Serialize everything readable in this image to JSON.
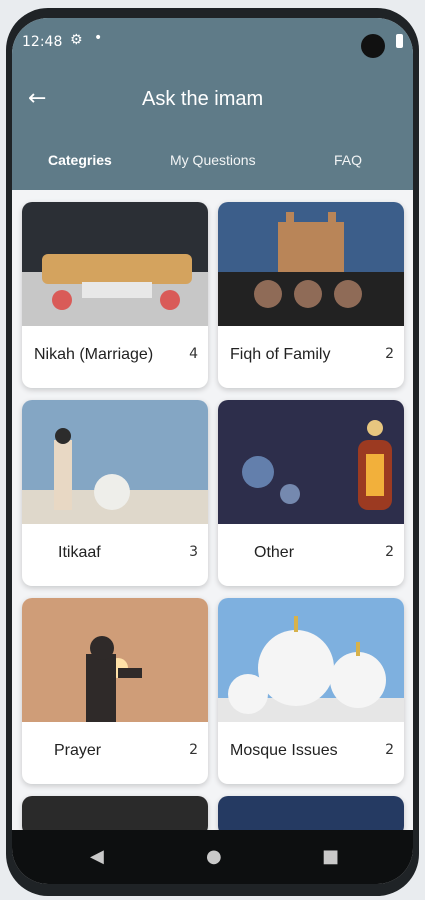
{
  "status": {
    "time": "12:48",
    "icons": [
      "gear-icon",
      "dot-icon",
      "camera-icon",
      "battery-icon"
    ]
  },
  "appbar": {
    "title": "Ask the imam",
    "back_icon": "arrow-left-icon"
  },
  "tabs": [
    {
      "label": "Categries",
      "active": true
    },
    {
      "label": "My Questions",
      "active": false
    },
    {
      "label": "FAQ",
      "active": false
    }
  ],
  "cards": [
    {
      "label": "Nikah (Marriage)",
      "count": "4"
    },
    {
      "label": "Fiqh of Family",
      "count": "2"
    },
    {
      "label": "Itikaaf",
      "count": "3"
    },
    {
      "label": "Other",
      "count": "2"
    },
    {
      "label": "Prayer",
      "count": "2"
    },
    {
      "label": "Mosque Issues",
      "count": "2"
    }
  ],
  "colors": {
    "primary": "#5f7b88",
    "surface": "#f3f4f6"
  },
  "navbar": {
    "buttons": [
      "back-nav-icon",
      "home-nav-icon",
      "recents-nav-icon"
    ]
  }
}
